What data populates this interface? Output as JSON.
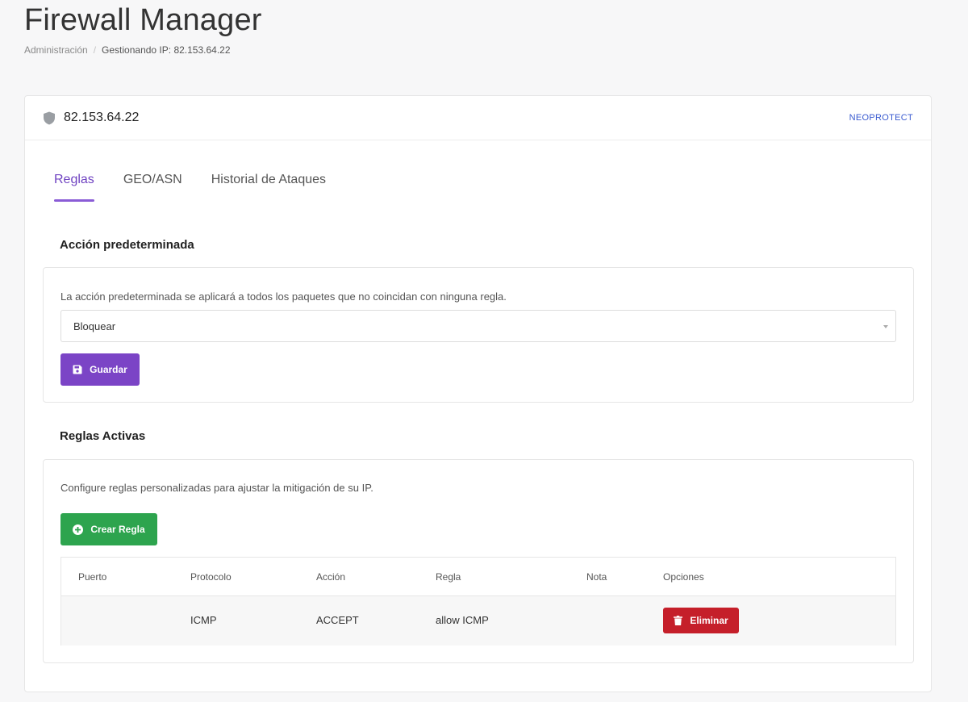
{
  "page": {
    "title": "Firewall Manager",
    "breadcrumb": {
      "root": "Administración",
      "separator": "/",
      "current": "Gestionando IP: 82.153.64.22"
    }
  },
  "card": {
    "ip": "82.153.64.22",
    "provider": "NEOPROTECT"
  },
  "tabs": [
    {
      "label": "Reglas",
      "active": true
    },
    {
      "label": "GEO/ASN",
      "active": false
    },
    {
      "label": "Historial de Ataques",
      "active": false
    }
  ],
  "default_action": {
    "title": "Acción predeterminada",
    "description": "La acción predeterminada se aplicará a todos los paquetes que no coincidan con ninguna regla.",
    "selected": "Bloquear",
    "save_label": "Guardar"
  },
  "active_rules": {
    "title": "Reglas Activas",
    "description": "Configure reglas personalizadas para ajustar la mitigación de su IP.",
    "create_label": "Crear Regla",
    "columns": [
      "Puerto",
      "Protocolo",
      "Acción",
      "Regla",
      "Nota",
      "Opciones"
    ],
    "rows": [
      {
        "port": "",
        "protocol": "ICMP",
        "action": "ACCEPT",
        "rule": "allow ICMP",
        "note": "",
        "delete_label": "Eliminar"
      }
    ]
  },
  "icons": {
    "shield": "shield-icon",
    "save": "floppy-disk-icon",
    "create": "plus-circle-icon",
    "delete": "trash-icon"
  },
  "colors": {
    "accent": "#7b44c6",
    "success": "#2da44e",
    "danger": "#c51f2a",
    "link": "#3a5bd0"
  }
}
